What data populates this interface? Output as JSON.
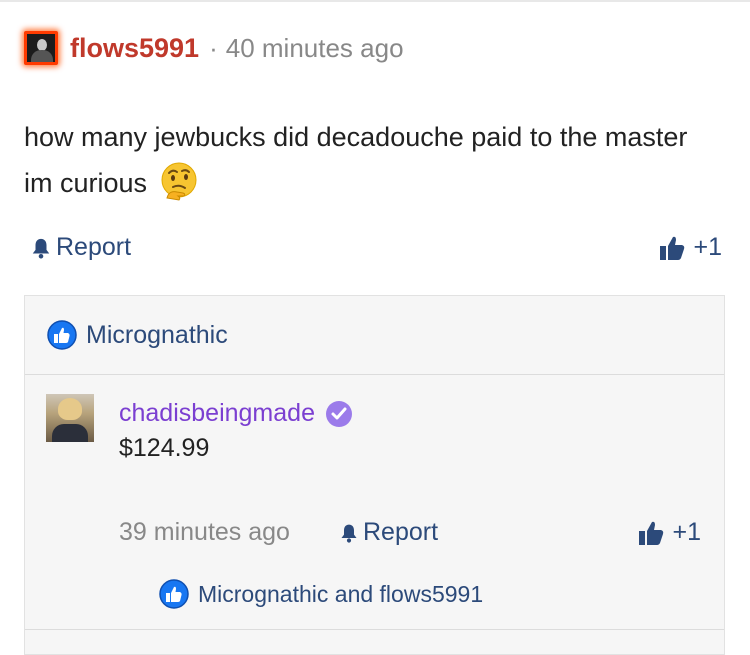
{
  "colors": {
    "accent_link": "#2c4a7a",
    "op_username": "#c0392b",
    "reply_username": "#7b3fd1",
    "like_badge": "#1877f2",
    "verified": "#9b7bea",
    "muted": "#888888"
  },
  "post": {
    "username": "flows5991",
    "separator": "·",
    "time": "40 minutes ago",
    "body": "how many jewbucks did decadouche paid to the master im curious",
    "body_emoji": "thinking-face-icon",
    "report_label": "Report",
    "vote_label": "+1"
  },
  "reactions": {
    "label": "Micrognathic"
  },
  "reply": {
    "username": "chadisbeingmade",
    "verified": true,
    "amount": "$124.99",
    "time": "39 minutes ago",
    "report_label": "Report",
    "vote_label": "+1",
    "reactors": "Micrognathic and flows5991"
  }
}
